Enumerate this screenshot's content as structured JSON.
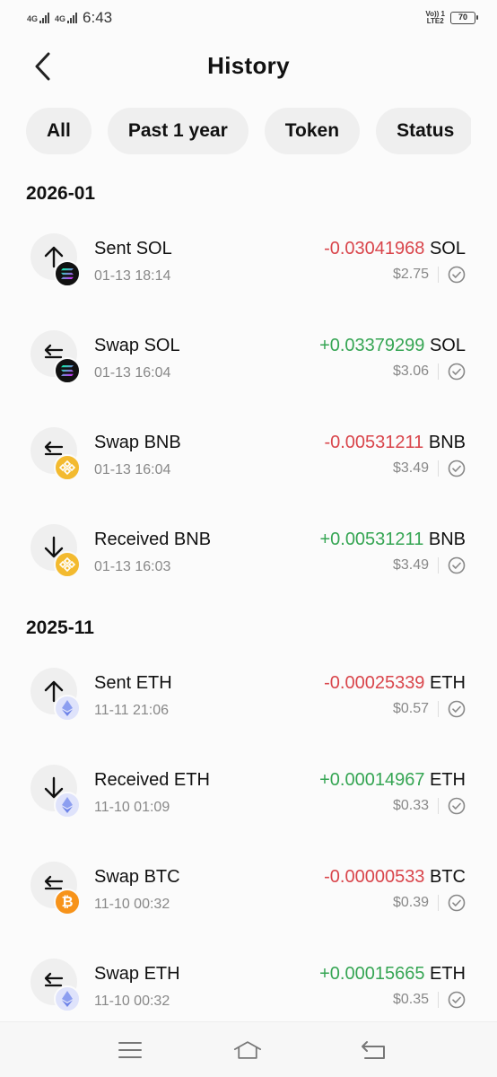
{
  "status_bar": {
    "network_1": "4G",
    "network_2": "4G",
    "time": "6:43",
    "volte_1": "Vo)) 1",
    "volte_2": "LTE2",
    "battery": "70"
  },
  "header": {
    "title": "History",
    "back_icon": "chevron-left-icon"
  },
  "filters": [
    {
      "label": "All"
    },
    {
      "label": "Past 1 year"
    },
    {
      "label": "Token"
    },
    {
      "label": "Status"
    }
  ],
  "sections": [
    {
      "title": "2026-01",
      "transactions": [
        {
          "type": "sent",
          "name": "Sent SOL",
          "time": "01-13 18:14",
          "amount": "-0.03041968",
          "unit": "SOL",
          "usd": "$2.75",
          "token": "sol"
        },
        {
          "type": "swap",
          "name": "Swap SOL",
          "time": "01-13 16:04",
          "amount": "+0.03379299",
          "unit": "SOL",
          "usd": "$3.06",
          "token": "sol"
        },
        {
          "type": "swap",
          "name": "Swap BNB",
          "time": "01-13 16:04",
          "amount": "-0.00531211",
          "unit": "BNB",
          "usd": "$3.49",
          "token": "bnb"
        },
        {
          "type": "received",
          "name": "Received BNB",
          "time": "01-13 16:03",
          "amount": "+0.00531211",
          "unit": "BNB",
          "usd": "$3.49",
          "token": "bnb"
        }
      ]
    },
    {
      "title": "2025-11",
      "transactions": [
        {
          "type": "sent",
          "name": "Sent ETH",
          "time": "11-11 21:06",
          "amount": "-0.00025339",
          "unit": "ETH",
          "usd": "$0.57",
          "token": "eth"
        },
        {
          "type": "received",
          "name": "Received ETH",
          "time": "11-10 01:09",
          "amount": "+0.00014967",
          "unit": "ETH",
          "usd": "$0.33",
          "token": "eth"
        },
        {
          "type": "swap",
          "name": "Swap BTC",
          "time": "11-10 00:32",
          "amount": "-0.00000533",
          "unit": "BTC",
          "usd": "$0.39",
          "token": "btc"
        },
        {
          "type": "swap",
          "name": "Swap ETH",
          "time": "11-10 00:32",
          "amount": "+0.00015665",
          "unit": "ETH",
          "usd": "$0.35",
          "token": "eth"
        }
      ]
    }
  ],
  "colors": {
    "negative": "#d9454b",
    "positive": "#35a553",
    "bnb": "#f3ba2f",
    "btc": "#f7931a",
    "eth": "#dfe3fb",
    "sol": "#111111"
  },
  "navbar": {
    "items": [
      {
        "icon": "menu-icon"
      },
      {
        "icon": "home-icon"
      },
      {
        "icon": "back-icon"
      }
    ]
  }
}
